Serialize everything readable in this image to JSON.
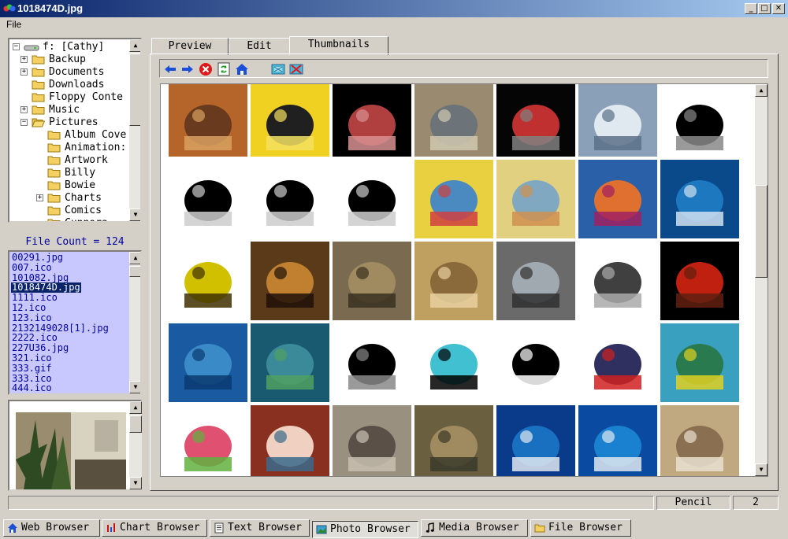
{
  "window": {
    "title": "1018474D.jpg",
    "minimize": "_",
    "maximize": "□",
    "close": "✕"
  },
  "menu": {
    "file": "File"
  },
  "tree": {
    "root": "f: [Cathy]",
    "items": [
      {
        "label": "Backup",
        "expander": "+"
      },
      {
        "label": "Documents",
        "expander": "+"
      },
      {
        "label": "Downloads",
        "expander": ""
      },
      {
        "label": "Floppy Conte",
        "expander": ""
      },
      {
        "label": "Music",
        "expander": "+"
      },
      {
        "label": "Pictures",
        "expander": "−"
      },
      {
        "label": "Album Cove",
        "expander": ""
      },
      {
        "label": "Animation:",
        "expander": ""
      },
      {
        "label": "Artwork",
        "expander": ""
      },
      {
        "label": "Billy",
        "expander": ""
      },
      {
        "label": "Bowie",
        "expander": ""
      },
      {
        "label": "Charts",
        "expander": "+"
      },
      {
        "label": "Comics",
        "expander": ""
      },
      {
        "label": "Cunnora",
        "expander": ""
      }
    ]
  },
  "file_count_label": "File Count = 124",
  "files": [
    "00291.jpg",
    "007.ico",
    "101082.jpg",
    "1018474D.jpg",
    "1111.ico",
    "12.ico",
    "123.ico",
    "2132149028[1].jpg",
    "2222.ico",
    "227U36.jpg",
    "321.ico",
    "333.gif",
    "333.ico",
    "444.ico"
  ],
  "selected_file_index": 3,
  "tabs": [
    "Preview",
    "Edit",
    "Thumbnails"
  ],
  "active_tab": "Thumbnails",
  "toolbar_icons": [
    "back-arrow-icon",
    "forward-arrow-icon",
    "stop-icon",
    "refresh-icon",
    "home-icon",
    "thumbnail-view-icon",
    "thumbnail-delete-icon"
  ],
  "thumbnails": [
    [
      "flower-woman-art",
      "computer-user-sign",
      "pentagram-art",
      "shark-photo",
      "rocket-art",
      "man-with-hat-photo",
      "sketch-lineart"
    ],
    [
      "comic-page-1",
      "comic-page-2",
      "comic-page-3",
      "comic-color-1",
      "comic-color-2",
      "collage",
      "shark-blue"
    ],
    [
      "coffee-mug-icon",
      "baby-at-computer",
      "fox-photo",
      "man-straw-hat",
      "man-at-console",
      "line-drawing",
      "red-creature"
    ],
    [
      "dolphin-underwater",
      "dolphin-close",
      "stormtrooper-art",
      "x-logo-icon",
      "arrow-icon",
      "hockey-kid",
      "dolphin-reef"
    ],
    [
      "roses-strawberry",
      "little-girl",
      "squirrel",
      "howling-wolf",
      "shark-swim",
      "shark-swim-2",
      "wolf-howl-2"
    ]
  ],
  "status": {
    "tool": "Pencil",
    "value": "2"
  },
  "taskbar": [
    {
      "label": "Web Browser",
      "icon": "house-icon"
    },
    {
      "label": "Chart Browser",
      "icon": "chart-icon"
    },
    {
      "label": "Text Browser",
      "icon": "notepad-icon"
    },
    {
      "label": "Photo Browser",
      "icon": "photo-icon"
    },
    {
      "label": "Media Browser",
      "icon": "music-note-icon"
    },
    {
      "label": "File Browser",
      "icon": "folder-icon"
    }
  ],
  "active_task": "Photo Browser",
  "colors": {
    "titlebar": "#0a246a",
    "file_list_bg": "#c8c8ff",
    "file_text": "#0000a0",
    "selection": "#0a246a"
  }
}
